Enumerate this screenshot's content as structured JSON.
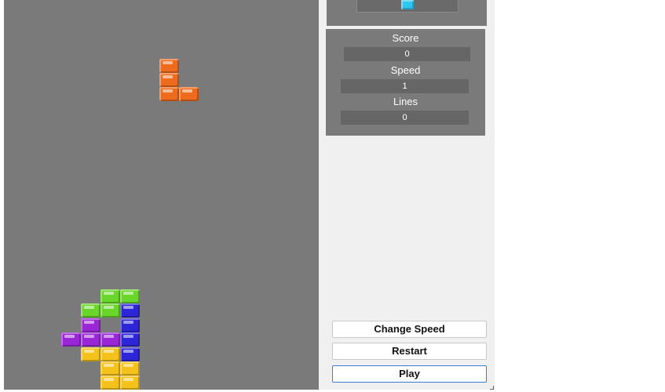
{
  "colors": {
    "board": "#7a7a7a",
    "panel": "#f0f0f0",
    "orange": "#ee6a1c",
    "green": "#6ad52a",
    "blue": "#2d25d8",
    "purple": "#9a27d6",
    "yellow": "#f5c21b",
    "cyan": "#2ec7f2"
  },
  "stats": {
    "score_label": "Score",
    "score_value": "0",
    "speed_label": "Speed",
    "speed_value": "1",
    "lines_label": "Lines",
    "lines_value": "0"
  },
  "buttons": {
    "change_speed": "Change Speed",
    "restart": "Restart",
    "play": "Play"
  },
  "next_piece": {
    "type": "I",
    "color": "cyan"
  },
  "board": {
    "falling_piece": {
      "type": "L",
      "color": "orange",
      "cells": [
        [
          8,
          4
        ],
        [
          8,
          5
        ],
        [
          8,
          6
        ],
        [
          9,
          6
        ]
      ]
    },
    "stack": [
      {
        "col": 5,
        "row": 20,
        "color": "green"
      },
      {
        "col": 6,
        "row": 20,
        "color": "green"
      },
      {
        "col": 4,
        "row": 21,
        "color": "green"
      },
      {
        "col": 5,
        "row": 21,
        "color": "green"
      },
      {
        "col": 6,
        "row": 21,
        "color": "blue"
      },
      {
        "col": 4,
        "row": 22,
        "color": "purple"
      },
      {
        "col": 6,
        "row": 22,
        "color": "blue"
      },
      {
        "col": 3,
        "row": 23,
        "color": "purple"
      },
      {
        "col": 4,
        "row": 23,
        "color": "purple"
      },
      {
        "col": 5,
        "row": 23,
        "color": "purple"
      },
      {
        "col": 6,
        "row": 23,
        "color": "blue"
      },
      {
        "col": 4,
        "row": 24,
        "color": "yellow"
      },
      {
        "col": 5,
        "row": 24,
        "color": "yellow"
      },
      {
        "col": 6,
        "row": 24,
        "color": "blue"
      },
      {
        "col": 5,
        "row": 25,
        "color": "yellow"
      },
      {
        "col": 6,
        "row": 25,
        "color": "yellow"
      },
      {
        "col": 5,
        "row": 26,
        "color": "yellow"
      },
      {
        "col": 6,
        "row": 26,
        "color": "yellow"
      }
    ]
  }
}
